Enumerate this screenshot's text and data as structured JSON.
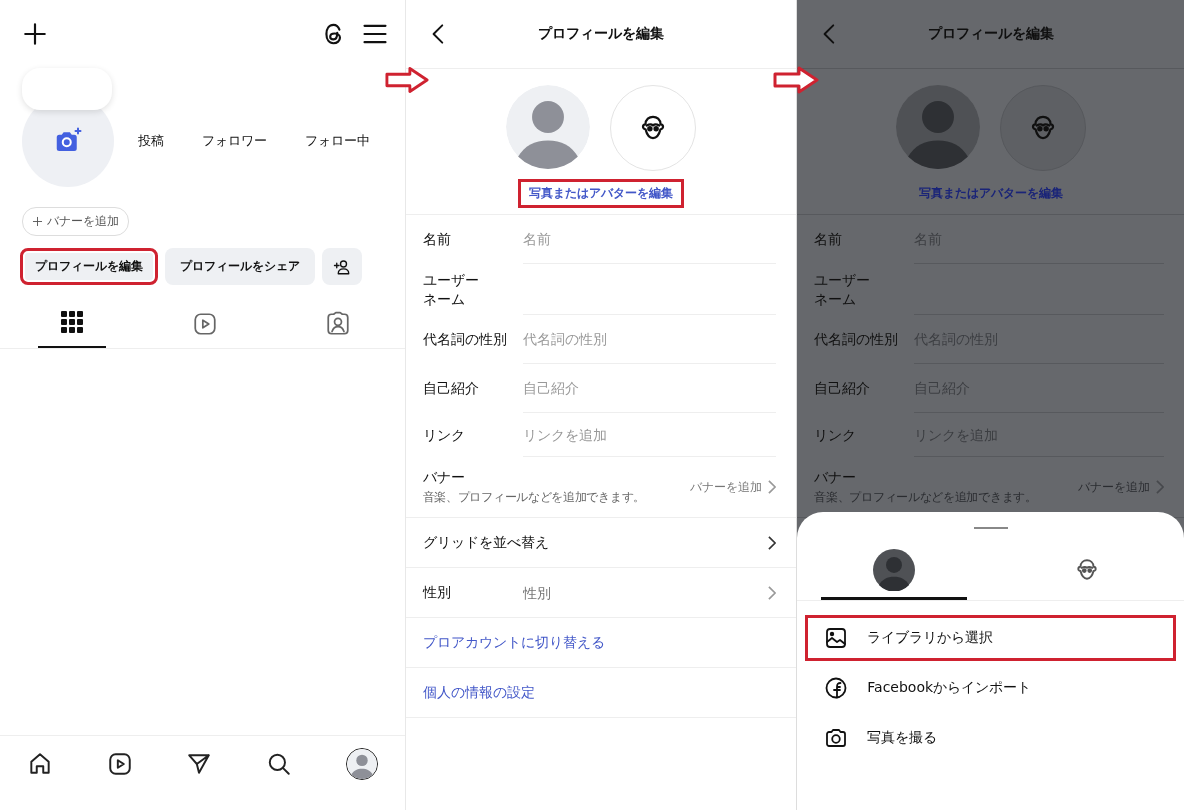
{
  "profile_screen": {
    "stats": [
      "投稿",
      "フォロワー",
      "フォロー中"
    ],
    "banner_chip": "バナーを追加",
    "buttons": [
      {
        "kind": "text",
        "label": "プロフィールを編集",
        "highlighted": true
      },
      {
        "kind": "text",
        "label": "プロフィールをシェア",
        "highlighted": false
      },
      {
        "kind": "add-person",
        "highlighted": false
      }
    ],
    "tabs": [
      {
        "kind": "grid",
        "selected": true
      },
      {
        "kind": "reels",
        "selected": false
      },
      {
        "kind": "tagged",
        "selected": false
      }
    ],
    "nav": [
      {
        "kind": "home"
      },
      {
        "kind": "reels"
      },
      {
        "kind": "send"
      },
      {
        "kind": "search"
      },
      {
        "kind": "profile"
      }
    ]
  },
  "edit_screen": {
    "title": "プロフィールを編集",
    "avatar_link": {
      "label": "写真またはアバターを編集",
      "highlighted": true
    },
    "fields": [
      {
        "kind": "field",
        "label": "名前",
        "placeholder": "名前"
      },
      {
        "kind": "field",
        "label_lines": [
          "ユーザー",
          "ネーム"
        ]
      },
      {
        "kind": "field",
        "label": "代名詞の性別",
        "placeholder": "代名詞の性別"
      },
      {
        "kind": "field",
        "label": "自己紹介",
        "placeholder": "自己紹介"
      },
      {
        "kind": "field",
        "label": "リンク",
        "placeholder": "リンクを追加"
      },
      {
        "kind": "banner",
        "label": "バナー",
        "description": "音楽、プロフィールなどを追加できます。",
        "action": "バナーを追加"
      },
      {
        "kind": "nav",
        "label": "グリッドを並べ替え"
      },
      {
        "kind": "select",
        "label": "性別",
        "placeholder": "性別"
      },
      {
        "kind": "link",
        "label": "プロアカウントに切り替える"
      },
      {
        "kind": "link",
        "label": "個人の情報の設定"
      }
    ]
  },
  "dimmed_screen": {
    "title": "プロフィールを編集",
    "avatar_link": {
      "label": "写真またはアバターを編集",
      "highlighted": false
    },
    "fields": [
      {
        "kind": "field",
        "label": "名前",
        "placeholder": "名前"
      },
      {
        "kind": "field",
        "label_lines": [
          "ユーザー",
          "ネーム"
        ]
      },
      {
        "kind": "field",
        "label": "代名詞の性別",
        "placeholder": "代名詞の性別"
      },
      {
        "kind": "field",
        "label": "自己紹介",
        "placeholder": "自己紹介"
      },
      {
        "kind": "field",
        "label": "リンク",
        "placeholder": "リンクを追加"
      },
      {
        "kind": "banner",
        "label": "バナー",
        "description": "音楽、プロフィールなどを追加できます。",
        "action": "バナーを追加"
      }
    ]
  },
  "sheet": {
    "tabs": [
      {
        "kind": "photo",
        "selected": true
      },
      {
        "kind": "avatar",
        "selected": false
      }
    ],
    "options": [
      {
        "kind": "library",
        "label": "ライブラリから選択",
        "highlighted": true
      },
      {
        "kind": "facebook",
        "label": "Facebookからインポート",
        "highlighted": false
      },
      {
        "kind": "camera",
        "label": "写真を撮る",
        "highlighted": false
      }
    ]
  }
}
